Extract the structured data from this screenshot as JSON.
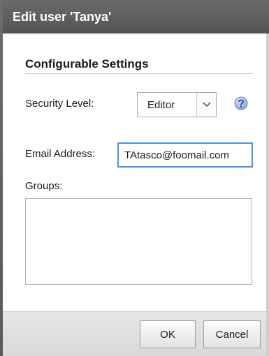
{
  "dialog": {
    "title": "Edit user 'Tanya'"
  },
  "section": {
    "title": "Configurable Settings"
  },
  "security_level": {
    "label": "Security Level:",
    "selected": "Editor",
    "arrow_icon": "chevron-down-icon",
    "help_icon": "help-icon"
  },
  "email": {
    "label": "Email Address:",
    "value": "TAtasco@foomail.com"
  },
  "groups": {
    "label": "Groups:"
  },
  "buttons": {
    "ok": "OK",
    "cancel": "Cancel"
  },
  "colors": {
    "titlebar": "#5f5f5f",
    "focus_border": "#4a8fe0",
    "help_icon": "#4a78c8"
  }
}
